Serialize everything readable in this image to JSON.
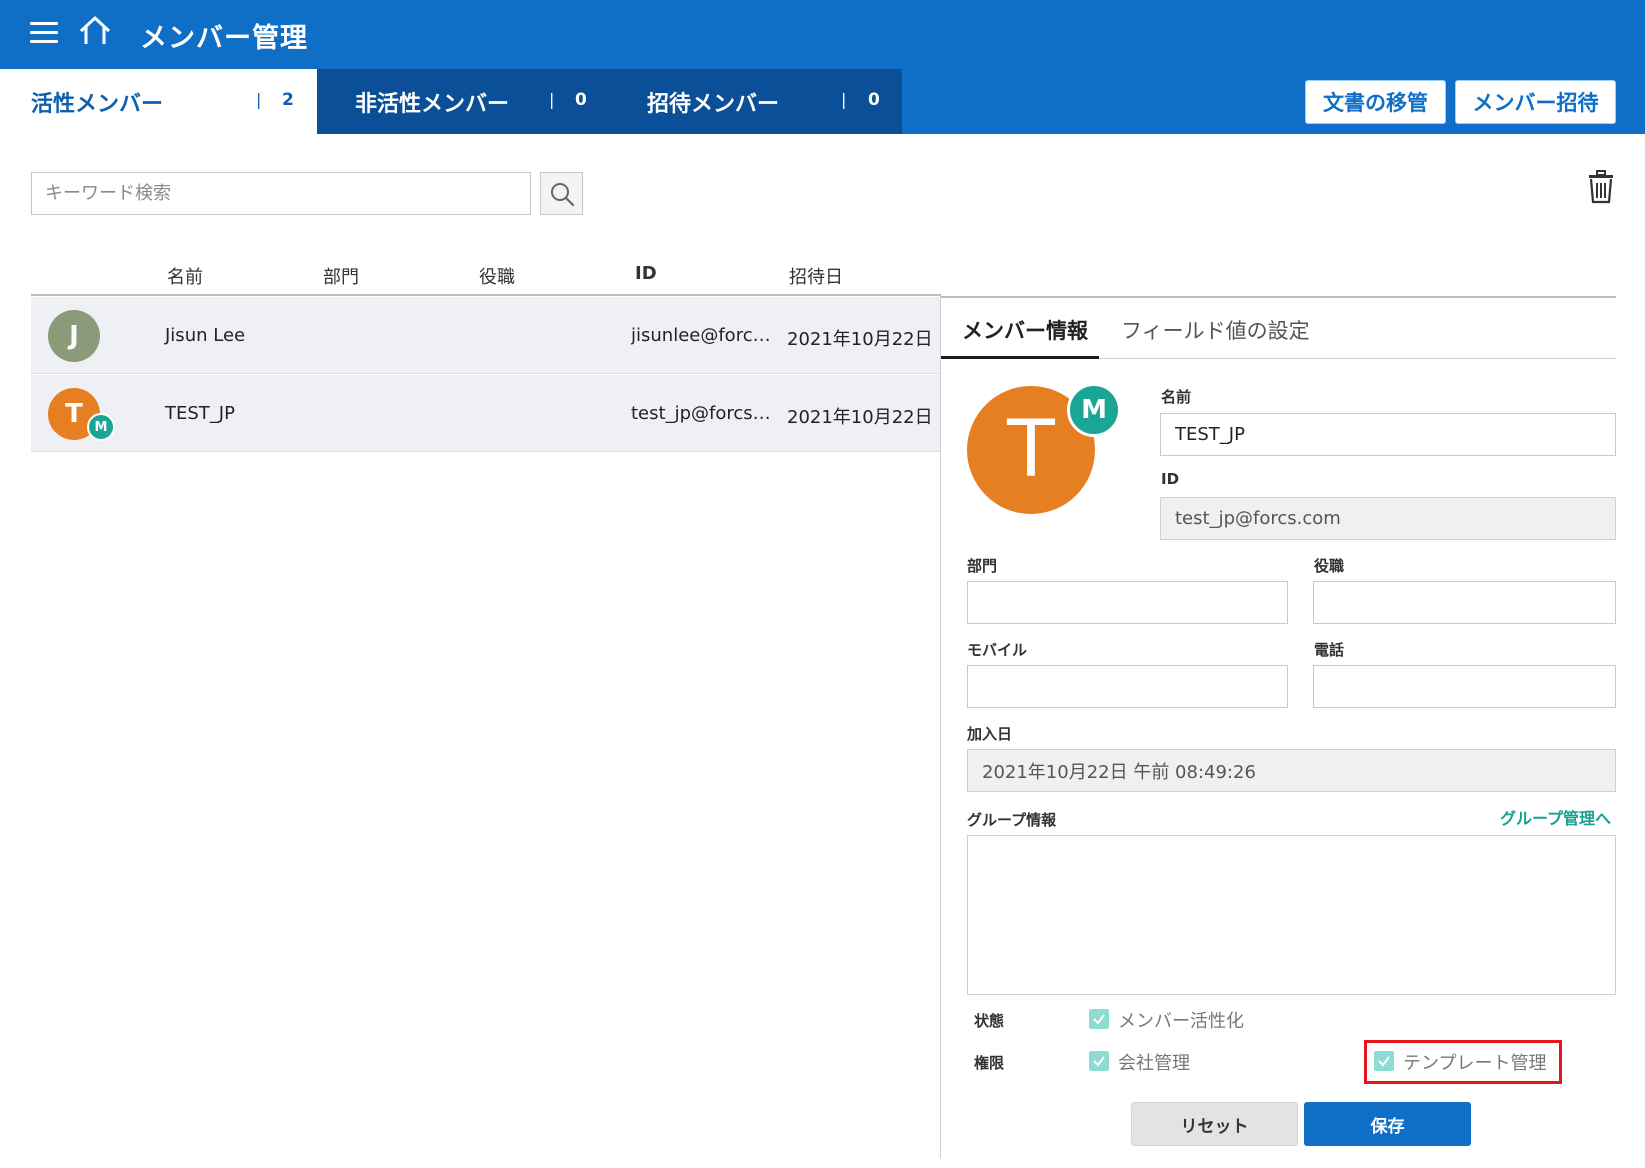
{
  "header": {
    "title": "メンバー管理",
    "menu_icon": "hamburger-menu-icon",
    "home_icon": "home-icon",
    "tabs": [
      {
        "label": "活性メンバー",
        "sep": "|",
        "count": "2"
      },
      {
        "label": "非活性メンバー",
        "sep": "|",
        "count": "0"
      },
      {
        "label": "招待メンバー",
        "sep": "|",
        "count": "0"
      }
    ],
    "buttons": {
      "transfer": "文書の移管",
      "invite": "メンバー招待"
    }
  },
  "search": {
    "placeholder": "キーワード検索",
    "value": ""
  },
  "table": {
    "columns": [
      "名前",
      "部門",
      "役職",
      "ID",
      "招待日"
    ],
    "rows": [
      {
        "avatar": "J",
        "name": "Jisun Lee",
        "dept": "",
        "position": "",
        "id": "jisunlee@forcs…",
        "date": "2021年10月22日",
        "badge": ""
      },
      {
        "avatar": "T",
        "name": "TEST_JP",
        "dept": "",
        "position": "",
        "id": "test_jp@forcs.…",
        "date": "2021年10月22日",
        "badge": "M"
      }
    ]
  },
  "detail": {
    "tabs": [
      "メンバー情報",
      "フィールド値の設定"
    ],
    "avatar": "T",
    "badge": "M",
    "labels": {
      "name": "名前",
      "id": "ID",
      "dept": "部門",
      "position": "役職",
      "mobile": "モバイル",
      "phone": "電話",
      "joined": "加入日",
      "group": "グループ情報"
    },
    "values": {
      "name": "TEST_JP",
      "id": "test_jp@forcs.com",
      "dept": "",
      "position": "",
      "mobile": "",
      "phone": "",
      "joined": "2021年10月22日 午前 08:49:26"
    },
    "group_link": "グループ管理へ",
    "status_label": "状態",
    "status_option": "メンバー活性化",
    "permission_label": "権限",
    "permission_company": "会社管理",
    "permission_template": "テンプレート管理",
    "reset": "リセット",
    "save": "保存"
  },
  "colors": {
    "header_bg": "#0f6fc7",
    "tab_dark": "#0a4f98",
    "accent_teal": "#1aa594",
    "avatar_j": "#8b9a79",
    "avatar_t": "#e67e22",
    "highlight": "#e8141c"
  }
}
